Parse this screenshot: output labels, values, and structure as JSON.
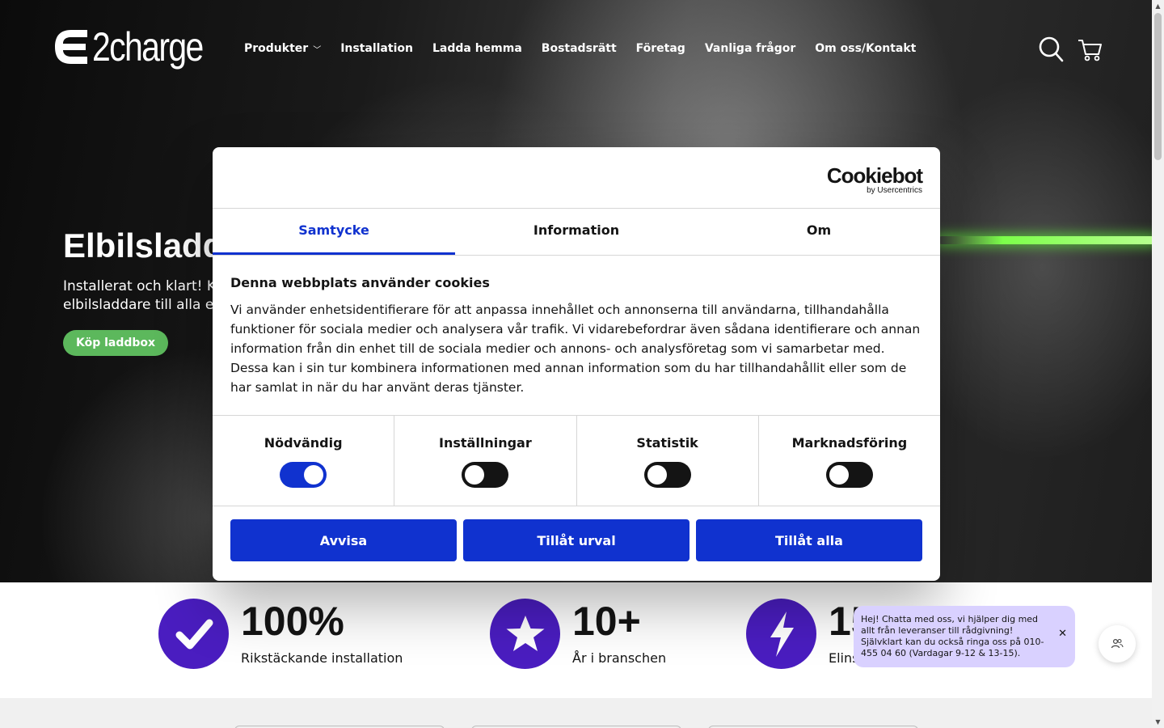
{
  "brand": {
    "logo_text": "2charge"
  },
  "nav": {
    "items": [
      {
        "label": "Produkter",
        "has_dropdown": true
      },
      {
        "label": "Installation"
      },
      {
        "label": "Ladda hemma"
      },
      {
        "label": "Bostadsrätt"
      },
      {
        "label": "Företag"
      },
      {
        "label": "Vanliga frågor"
      },
      {
        "label": "Om oss/Kontakt"
      }
    ],
    "icons": [
      "search-icon",
      "cart-icon"
    ]
  },
  "hero": {
    "title": "Elbilsladdare",
    "subtitle_line1": "Installerat och klart! Köp",
    "subtitle_line2": "elbilsladdare till alla elbilar",
    "cta": "Köp laddbox",
    "cta_color": "#5cb85c",
    "accent_line_color": "#7cff4a"
  },
  "cookie_dialog": {
    "provider": "Cookiebot",
    "provider_by": "by Usercentrics",
    "tabs": [
      {
        "label": "Samtycke",
        "active": true
      },
      {
        "label": "Information",
        "active": false
      },
      {
        "label": "Om",
        "active": false
      }
    ],
    "heading": "Denna webbplats använder cookies",
    "body": "Vi använder enhetsidentifierare för att anpassa innehållet och annonserna till användarna, tillhandahålla funktioner för sociala medier och analysera vår trafik. Vi vidarebefordrar även sådana identifierare och annan information från din enhet till de sociala medier och annons- och analysföretag som vi samarbetar med. Dessa kan i sin tur kombinera informationen med annan information som du har tillhandahållit eller som de har samlat in när du har använt deras tjänster.",
    "categories": [
      {
        "label": "Nödvändig",
        "enabled": true
      },
      {
        "label": "Inställningar",
        "enabled": false
      },
      {
        "label": "Statistik",
        "enabled": false
      },
      {
        "label": "Marknadsföring",
        "enabled": false
      }
    ],
    "buttons": {
      "reject": "Avvisa",
      "allow_selection": "Tillåt urval",
      "allow_all": "Tillåt alla"
    },
    "accent_color": "#1032cf"
  },
  "stats": [
    {
      "icon": "check-icon",
      "value": "100%",
      "label": "Rikstäckande installation"
    },
    {
      "icon": "star-icon",
      "value": "10+",
      "label": "År i branschen"
    },
    {
      "icon": "lightning-icon",
      "value": "15",
      "label": "Elinstallatörer"
    }
  ],
  "stats_icon_color": "#4a1dc0",
  "chat": {
    "message": "Hej! Chatta med oss, vi hjälper dig med allt från leveranser till rådgivning! Självklart kan du också ringa oss på 010-455 04 60 (Vardagar 9-12 & 13-15).",
    "close": "✕",
    "bubble_color": "#d9d1ff"
  }
}
